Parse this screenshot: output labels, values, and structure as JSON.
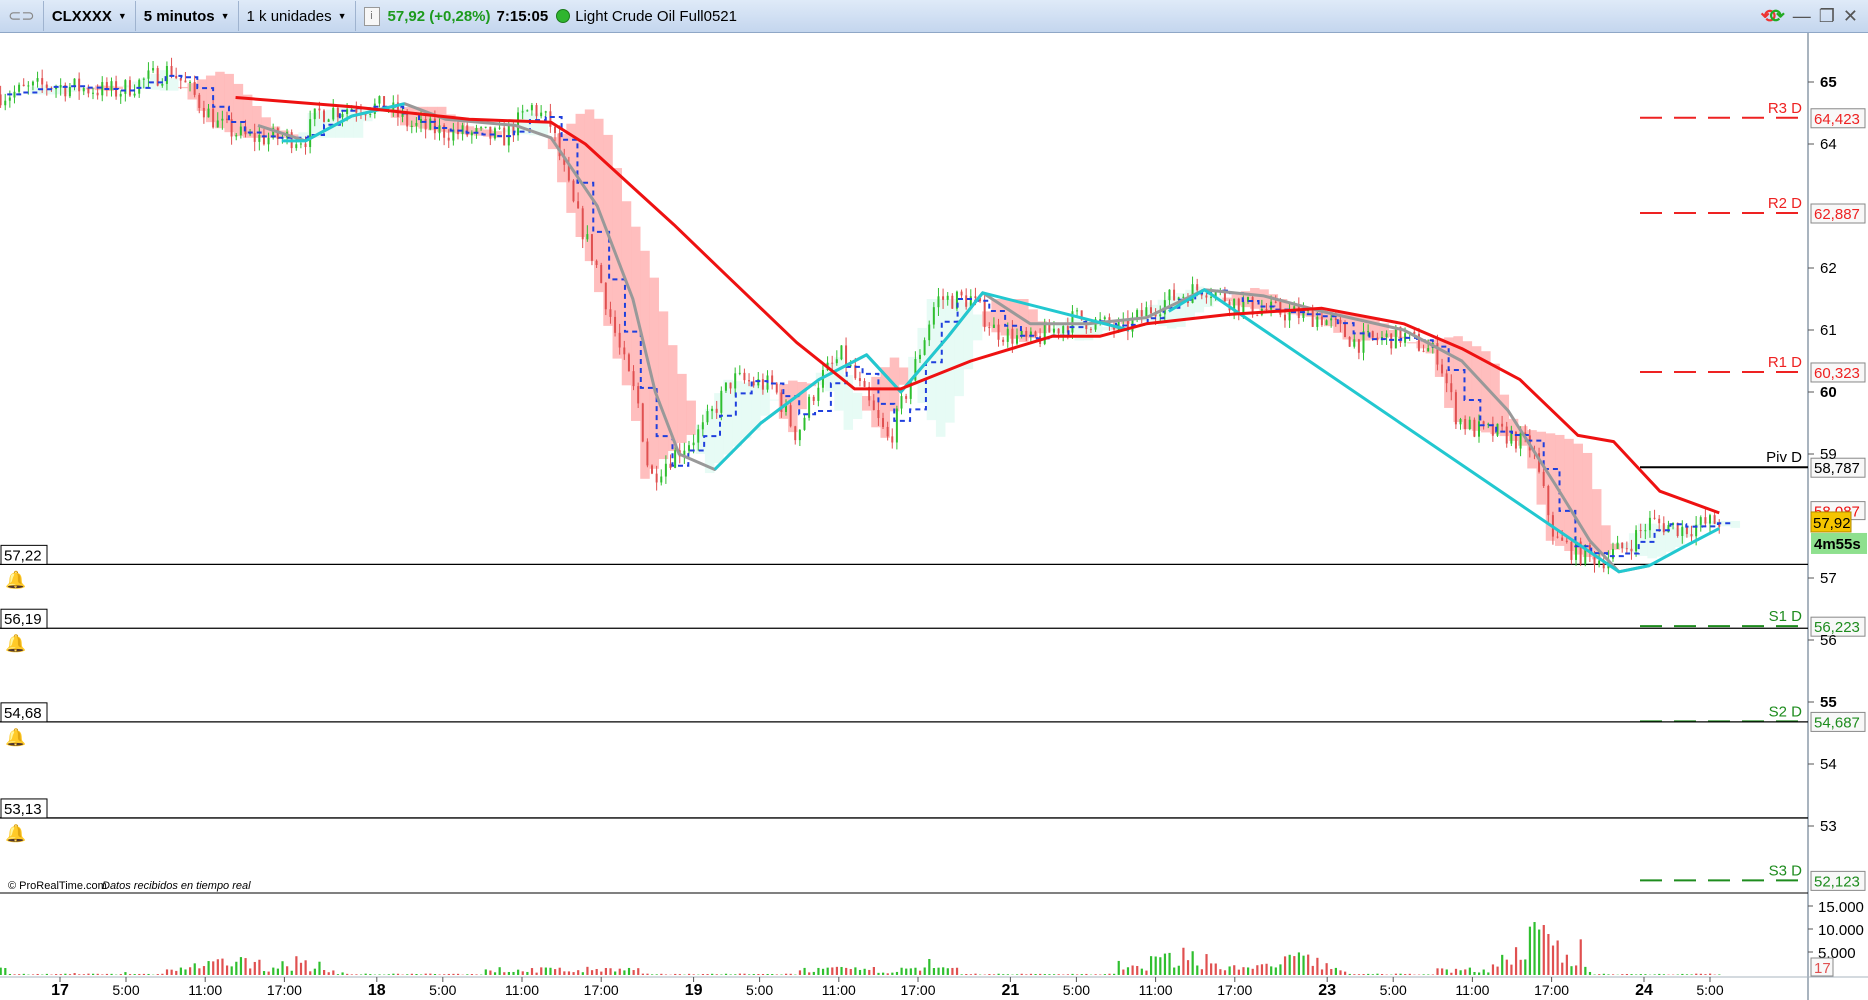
{
  "toolbar": {
    "symbol": "CLXXXX",
    "timeframe": "5 minutos",
    "units": "1 k unidades",
    "price_change": "57,92 (+0,28%)",
    "time": "7:15:05",
    "instrument_name": "Light Crude Oil Full0521",
    "icons": [
      "link-icon",
      "info-icon",
      "status-dot-icon",
      "refresh-icon",
      "minimize-icon",
      "restore-icon",
      "close-icon"
    ]
  },
  "footer_credit": "© ProRealTime.com",
  "footer_status": "Datos recibidos en tiempo real",
  "colors": {
    "up": "#2fbf2f",
    "down": "#e05050",
    "ma_red": "#ee1111",
    "ma_gray": "#999999",
    "ma_cyan": "#22c8d0",
    "tenkan": "#1f3fdd",
    "resistance": "#ee2222",
    "support": "#1e8c1e",
    "pivot": "#000000",
    "last_price_bg": "#f5c400",
    "timer_bg": "#8ee08e"
  },
  "chart_data": {
    "type": "line",
    "title": "Light Crude Oil Full0521 - 5 minutos",
    "ylim": [
      51.6,
      65.8
    ],
    "price_ticks": [
      "65",
      "64",
      "62",
      "61",
      "60",
      "59",
      "57",
      "56",
      "55",
      "54",
      "53"
    ],
    "price_tick_values": [
      65,
      64,
      62,
      61,
      60,
      59,
      57,
      56,
      55,
      54,
      53
    ],
    "x_day_labels": [
      {
        "label": "17",
        "h": 0
      },
      {
        "label": "18",
        "h": 24
      },
      {
        "label": "19",
        "h": 48
      },
      {
        "label": "21",
        "h": 72
      },
      {
        "label": "23",
        "h": 96
      },
      {
        "label": "24",
        "h": 120
      }
    ],
    "x_hour_labels": [
      {
        "label": "5:00",
        "h": 5
      },
      {
        "label": "11:00",
        "h": 11
      },
      {
        "label": "17:00",
        "h": 17
      },
      {
        "label": "5:00",
        "h": 29
      },
      {
        "label": "11:00",
        "h": 35
      },
      {
        "label": "17:00",
        "h": 41
      },
      {
        "label": "5:00",
        "h": 53
      },
      {
        "label": "11:00",
        "h": 59
      },
      {
        "label": "17:00",
        "h": 65
      },
      {
        "label": "5:00",
        "h": 77
      },
      {
        "label": "11:00",
        "h": 83
      },
      {
        "label": "17:00",
        "h": 89
      },
      {
        "label": "5:00",
        "h": 101
      },
      {
        "label": "11:00",
        "h": 107
      },
      {
        "label": "17:00",
        "h": 113
      },
      {
        "label": "5:00",
        "h": 125
      }
    ],
    "price": [
      [
        -4,
        64.8
      ],
      [
        -1,
        64.95
      ],
      [
        4.4,
        64.85
      ],
      [
        8.4,
        65.2
      ],
      [
        9.7,
        64.9
      ],
      [
        12,
        64.3
      ],
      [
        14.2,
        64.1
      ],
      [
        18.6,
        64.1
      ],
      [
        19.5,
        64.5
      ],
      [
        22.1,
        64.6
      ],
      [
        24.8,
        64.6
      ],
      [
        26.5,
        64.3
      ],
      [
        29.2,
        64.2
      ],
      [
        33.6,
        64.1
      ],
      [
        35.8,
        64.6
      ],
      [
        37.2,
        64.3
      ],
      [
        38.9,
        63.0
      ],
      [
        40.7,
        62.0
      ],
      [
        42.5,
        60.6
      ],
      [
        43.8,
        59.8
      ],
      [
        44.7,
        58.6
      ],
      [
        46,
        58.9
      ],
      [
        48.7,
        59.4
      ],
      [
        50.9,
        60.2
      ],
      [
        54,
        60.1
      ],
      [
        55.8,
        59.3
      ],
      [
        57.5,
        60.2
      ],
      [
        59.3,
        60.6
      ],
      [
        61.5,
        59.7
      ],
      [
        62.8,
        59.2
      ],
      [
        64.6,
        60.3
      ],
      [
        66.4,
        61.5
      ],
      [
        69,
        61.5
      ],
      [
        70.8,
        61.0
      ],
      [
        73.5,
        60.8
      ],
      [
        77,
        61.2
      ],
      [
        78.8,
        61.1
      ],
      [
        80.5,
        61.0
      ],
      [
        82.3,
        61.3
      ],
      [
        84,
        61.5
      ],
      [
        86.7,
        61.7
      ],
      [
        89.4,
        61.4
      ],
      [
        92,
        61.3
      ],
      [
        95.6,
        61.2
      ],
      [
        98.2,
        60.8
      ],
      [
        101.8,
        60.9
      ],
      [
        104.4,
        60.6
      ],
      [
        105.8,
        59.6
      ],
      [
        107,
        59.4
      ],
      [
        109.7,
        59.3
      ],
      [
        111.5,
        59.1
      ],
      [
        113.3,
        57.6
      ],
      [
        115,
        57.4
      ],
      [
        116.8,
        57.3
      ],
      [
        118.6,
        57.5
      ],
      [
        120.4,
        57.9
      ],
      [
        123,
        57.8
      ],
      [
        125.7,
        57.92
      ]
    ],
    "ma_red": [
      [
        13.3,
        64.75
      ],
      [
        22.1,
        64.6
      ],
      [
        31,
        64.4
      ],
      [
        37.2,
        64.35
      ],
      [
        39.8,
        64.0
      ],
      [
        43.4,
        63.3
      ],
      [
        46.5,
        62.7
      ],
      [
        50.4,
        61.9
      ],
      [
        55.8,
        60.8
      ],
      [
        60.2,
        60.05
      ],
      [
        63.7,
        60.05
      ],
      [
        69,
        60.5
      ],
      [
        75.2,
        60.9
      ],
      [
        78.8,
        60.9
      ],
      [
        82.3,
        61.1
      ],
      [
        88.5,
        61.25
      ],
      [
        95.6,
        61.35
      ],
      [
        101.8,
        61.1
      ],
      [
        106.2,
        60.7
      ],
      [
        110.6,
        60.2
      ],
      [
        115,
        59.3
      ],
      [
        117.7,
        59.2
      ],
      [
        121.2,
        58.4
      ],
      [
        125.7,
        58.05
      ]
    ],
    "ma_gray": [
      [
        15,
        64.3
      ],
      [
        18.6,
        64.05
      ],
      [
        22.1,
        64.45
      ],
      [
        26.1,
        64.65
      ],
      [
        29.2,
        64.4
      ],
      [
        34.5,
        64.3
      ],
      [
        37.2,
        64.1
      ],
      [
        40.7,
        63.0
      ],
      [
        43.4,
        61.5
      ],
      [
        45.1,
        60.0
      ],
      [
        46.9,
        59.0
      ],
      [
        49.6,
        58.75
      ],
      [
        53.1,
        59.5
      ],
      [
        57.5,
        60.2
      ],
      [
        61.1,
        60.6
      ],
      [
        63.7,
        60.0
      ],
      [
        67.3,
        60.9
      ],
      [
        69.9,
        61.6
      ],
      [
        73.5,
        61.1
      ],
      [
        77.9,
        61.1
      ],
      [
        82.3,
        61.2
      ],
      [
        86.7,
        61.65
      ],
      [
        91.2,
        61.55
      ],
      [
        95.6,
        61.3
      ],
      [
        101.8,
        61.0
      ],
      [
        106.2,
        60.5
      ],
      [
        109.7,
        59.7
      ],
      [
        113.3,
        58.5
      ],
      [
        115.9,
        57.6
      ],
      [
        118.1,
        57.1
      ],
      [
        120.4,
        57.2
      ]
    ],
    "ma_cyan": [
      [
        16.8,
        64.05
      ],
      [
        18.6,
        64.05
      ],
      [
        22.1,
        64.45
      ],
      [
        26.1,
        64.65
      ],
      [
        49.6,
        58.75
      ],
      [
        53.1,
        59.5
      ],
      [
        57.5,
        60.2
      ],
      [
        61.1,
        60.6
      ],
      [
        63.7,
        60.0
      ],
      [
        67.3,
        60.9
      ],
      [
        69.9,
        61.6
      ],
      [
        81,
        61.0
      ],
      [
        84,
        61.3
      ],
      [
        86.7,
        61.65
      ],
      [
        118.1,
        57.1
      ],
      [
        120.4,
        57.2
      ],
      [
        123,
        57.5
      ],
      [
        125.7,
        57.8
      ]
    ],
    "pivots": [
      {
        "label": "R3 D",
        "value": 64.423,
        "text": "64,423",
        "kind": "resistance"
      },
      {
        "label": "R2 D",
        "value": 62.887,
        "text": "62,887",
        "kind": "resistance"
      },
      {
        "label": "R1 D",
        "value": 60.323,
        "text": "60,323",
        "kind": "resistance"
      },
      {
        "label": "Piv D",
        "value": 58.787,
        "text": "58,787",
        "kind": "pivot"
      },
      {
        "label": "S1 D",
        "value": 56.223,
        "text": "56,223",
        "kind": "support"
      },
      {
        "label": "S2 D",
        "value": 54.687,
        "text": "54,687",
        "kind": "support"
      },
      {
        "label": "S3 D",
        "value": 52.123,
        "text": "52,123",
        "kind": "support"
      }
    ],
    "alerts": [
      {
        "value": 57.22,
        "text": "57,22"
      },
      {
        "value": 56.19,
        "text": "56,19"
      },
      {
        "value": 54.68,
        "text": "54,68"
      },
      {
        "value": 53.13,
        "text": "53,13"
      }
    ],
    "ma_value_tag": {
      "value": 58.087,
      "text": "58,087"
    },
    "last_price_tag": {
      "value": 57.92,
      "text": "57,92"
    },
    "bar_timer": "4m55s",
    "volume": {
      "ticks": [
        "15.000",
        "10.000",
        "5.000"
      ],
      "tick_values": [
        15000,
        10000,
        5000
      ],
      "last_tag": "17",
      "spikes": [
        [
          13,
          4000
        ],
        [
          18,
          3500
        ],
        [
          94,
          8500
        ],
        [
          112,
          16000
        ],
        [
          86,
          5000
        ],
        [
          84,
          4000
        ]
      ]
    }
  }
}
